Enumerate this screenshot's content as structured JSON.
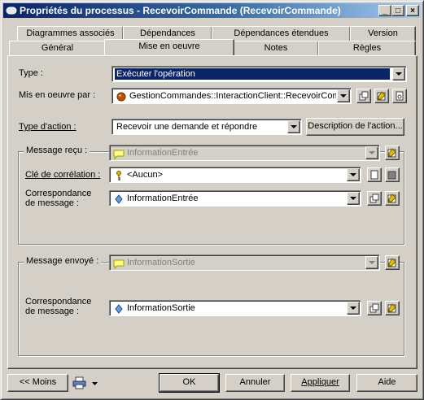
{
  "window": {
    "title": "Propriétés du processus - RecevoirCommande (RecevoirCommande)",
    "buttons": {
      "minimize": "_",
      "maximize": "□",
      "close": "×"
    }
  },
  "tabs": {
    "row_top": [
      "Diagrammes associés",
      "Dépendances",
      "Dépendances étendues",
      "Version"
    ],
    "row_bottom": [
      "Général",
      "Mise en oeuvre",
      "Notes",
      "Règles"
    ],
    "active": "Mise en oeuvre"
  },
  "form": {
    "type_label": "Type :",
    "type_value": "Exécuter l'opération",
    "implemented_by_label": "Mis en oeuvre par :",
    "implemented_by_value": "GestionCommandes::InteractionClient::RecevoirComm",
    "action_type_label": "Type d'action :",
    "action_type_value": "Recevoir une demande et répondre",
    "action_description_button": "Description de l'action..."
  },
  "received": {
    "group_label": "Message reçu :",
    "message_value": "InformationEntrée",
    "correlation_label": "Clé de corrélation :",
    "correlation_value": "<Aucun>",
    "mapping_label_line1": "Correspondance",
    "mapping_label_line2": "de message :",
    "mapping_value": "InformationEntrée"
  },
  "sent": {
    "group_label": "Message envoyé :",
    "message_value": "InformationSortie",
    "mapping_label_line1": "Correspondance",
    "mapping_label_line2": "de message :",
    "mapping_value": "InformationSortie"
  },
  "footer": {
    "less_button": "<< Moins",
    "ok_button": "OK",
    "cancel_button": "Annuler",
    "apply_button": "Appliquer",
    "help_button": "Aide"
  },
  "colors": {
    "titlebar_start": "#0a246a",
    "titlebar_end": "#a6caf0",
    "face": "#d4d0c8",
    "selection": "#0a246a"
  },
  "icons": {
    "app": "process-icon",
    "implementer": "operation-icon",
    "message": "message-icon",
    "key": "key-icon",
    "mapping": "data-mapping-icon"
  }
}
